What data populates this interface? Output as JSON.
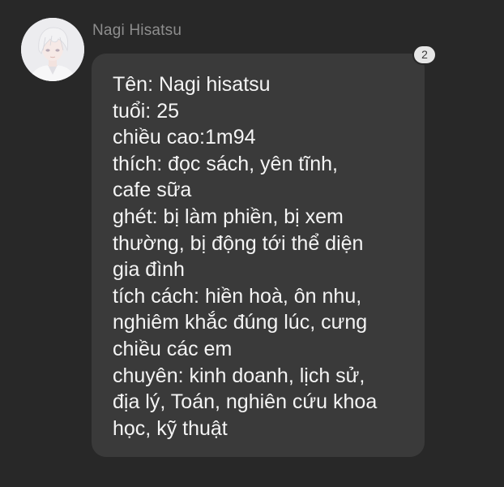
{
  "sender": {
    "name": "Nagi Hisatsu",
    "avatar": "avatar-anime-portrait"
  },
  "message": {
    "lines": [
      "Tên: Nagi hisatsu",
      "tuổi: 25",
      "chiều cao:1m94",
      "thích: đọc sách, yên tĩnh,",
      "cafe sữa",
      "ghét: bị làm phiền, bị xem",
      "thường, bị động tới thể diện",
      "gia đình",
      "tích cách: hiền hoà, ôn nhu,",
      "nghiêm khắc đúng lúc, cưng",
      "chiều các em",
      "chuyên: kinh doanh, lịch sử,",
      "địa lý, Toán, nghiên cứu khoa",
      "học, kỹ thuật"
    ],
    "reaction_count": "2"
  },
  "colors": {
    "background": "#282828",
    "bubble": "#3a3a3a",
    "text": "#f4f4f4",
    "name": "#8e8e8e",
    "badge": "#e6e6e6"
  }
}
